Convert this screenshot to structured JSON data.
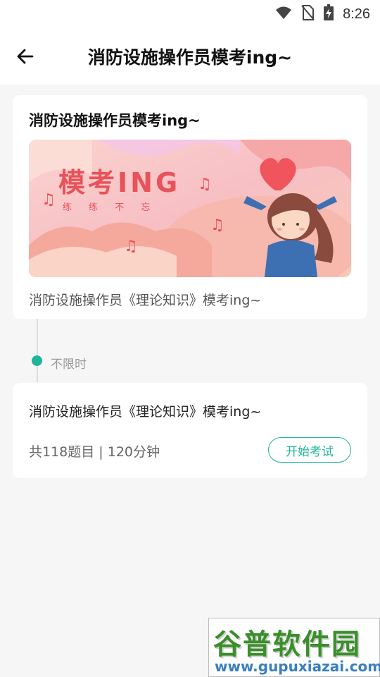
{
  "status_bar": {
    "time": "8:26"
  },
  "header": {
    "title": "消防设施操作员模考ing~"
  },
  "card": {
    "title": "消防设施操作员模考ing~",
    "banner": {
      "heading": "模考ING",
      "subtitle": "练 练 不 忘"
    },
    "description": "消防设施操作员《理论知识》模考ing~"
  },
  "timeline": {
    "label": "不限时"
  },
  "exam": {
    "title": "消防设施操作员《理论知识》模考ing~",
    "meta": "共118题目 | 120分钟",
    "start_label": "开始考试"
  },
  "watermark": {
    "main": "谷普软件园",
    "url": "www.gupuxiazai.com"
  },
  "colors": {
    "accent": "#1fb59a",
    "banner_text": "#e8525a"
  }
}
